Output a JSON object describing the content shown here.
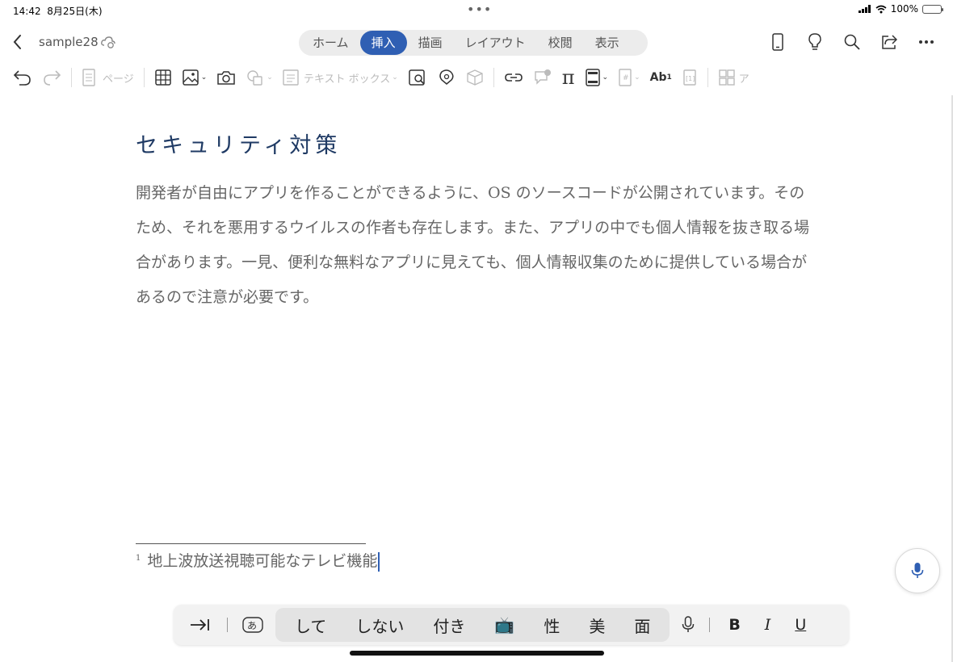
{
  "status": {
    "time": "14:42",
    "date": "8月25日(木)",
    "more": "•••",
    "battery": "100%"
  },
  "titlebar": {
    "doc_name": "sample28",
    "tabs": [
      {
        "label": "ホーム",
        "active": false
      },
      {
        "label": "挿入",
        "active": true
      },
      {
        "label": "描画",
        "active": false
      },
      {
        "label": "レイアウト",
        "active": false
      },
      {
        "label": "校閲",
        "active": false
      },
      {
        "label": "表示",
        "active": false
      }
    ],
    "accent": "#2f5fb3"
  },
  "ribbon": {
    "page_label": "ページ",
    "textbox_label": "テキスト ボックス",
    "pi": "π",
    "ab": "Ab",
    "ab_sup": "1",
    "cut_label": "ア"
  },
  "document": {
    "heading": "セキュリティ対策",
    "paragraph": "開発者が自由にアプリを作ることができるように、OS のソースコードが公開されています。そのため、それを悪用するウイルスの作者も存在します。また、アプリの中でも個人情報を抜き取る場合があります。一見、便利な無料なアプリに見えても、個人情報収集のために提供している場合があるので注意が必要です。",
    "footnote_number": "1",
    "footnote_text": "地上波放送視聴可能なテレビ機能"
  },
  "keyboard_bar": {
    "candidates": [
      "して",
      "しない",
      "付き",
      "📺",
      "性",
      "美",
      "面"
    ],
    "bold": "B",
    "italic": "I",
    "underline": "U"
  }
}
